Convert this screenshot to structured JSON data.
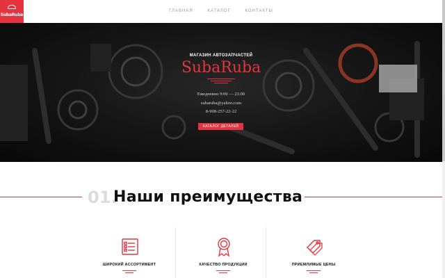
{
  "header": {
    "logo_text": "SubaRuba",
    "nav": [
      "ГЛАВНАЯ",
      "КАТАЛОГ",
      "КОНТАКТЫ"
    ]
  },
  "hero": {
    "subtitle": "МАГАЗИН АВТОЗАПЧАСТЕЙ",
    "title": "SubaRuba",
    "hours": "Ежедневно 9:00 — 21:00",
    "email": "subaruba@yahoo.com",
    "phone": "8-908-257-22-22",
    "button_label": "КАТАЛОГ ДЕТАЛЕЙ"
  },
  "advantages": {
    "number": "01.",
    "title": "Наши преимущества",
    "items": [
      {
        "label": "ШИРОКИЙ АССОРТИМЕНТ",
        "icon": "list-icon"
      },
      {
        "label": "КАЧЕСТВО ПРОДУКЦИИ",
        "icon": "award-ribbon-icon"
      },
      {
        "label": "ПРИЕМЛИМЫЕ ЦЕНЫ",
        "icon": "price-tags-icon"
      }
    ]
  },
  "colors": {
    "accent": "#e5343f",
    "hero_background": "#1a1a1a",
    "heading_number": "#dcdcdc"
  }
}
